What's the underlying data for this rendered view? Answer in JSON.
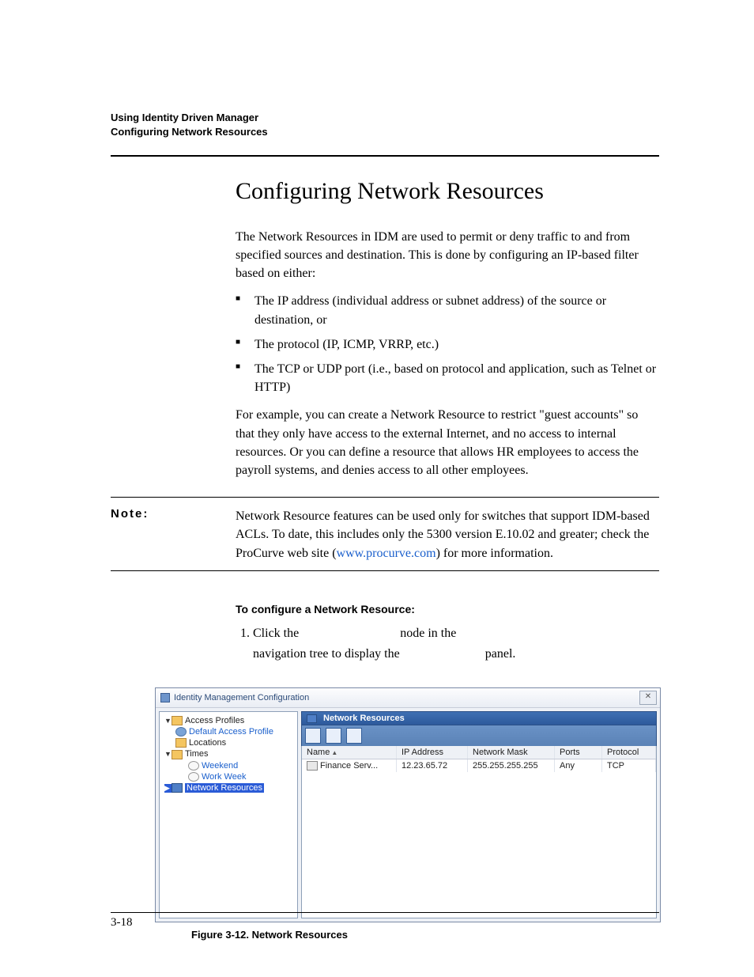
{
  "header": {
    "chapter": "Using Identity Driven Manager",
    "section": "Configuring Network Resources"
  },
  "title": "Configuring Network Resources",
  "intro": "The Network Resources in IDM are used to permit or deny traffic to and from specified sources and destination. This is done by configuring an IP-based filter based on either:",
  "bullets": [
    "The IP address (individual address or subnet address) of the source or destination, or",
    "The protocol (IP, ICMP, VRRP, etc.)",
    "The TCP or UDP port (i.e., based on protocol and application, such as Telnet or HTTP)"
  ],
  "example_para": "For example, you can create a Network Resource to restrict \"guest accounts\" so that they only have access to the external Internet, and no access to internal resources. Or you can define a resource that allows HR employees to access the payroll systems, and denies access to all other employees.",
  "note": {
    "label": "Note:",
    "text_before_link": "Network Resource features can be used only for switches that support IDM-based ACLs. To date, this includes only the 5300 version E.10.02 and greater; check the ProCurve web site (",
    "link_text": "www.procurve.com",
    "text_after_link": ") for more information."
  },
  "procedure": {
    "heading": "To configure a Network Resource:",
    "step1_a": "Click the ",
    "step1_b": " node in the ",
    "step1_c": "navigation tree to display the ",
    "step1_d": " panel."
  },
  "dialog": {
    "title": "Identity Management Configuration",
    "tree": {
      "access_profiles": "Access Profiles",
      "default_access_profile": "Default Access Profile",
      "locations": "Locations",
      "times": "Times",
      "weekend": "Weekend",
      "work_week": "Work Week",
      "network_resources": "Network Resources"
    },
    "panel_title": "Network Resources",
    "columns": {
      "name": "Name",
      "ip": "IP Address",
      "mask": "Network Mask",
      "ports": "Ports",
      "protocol": "Protocol"
    },
    "row": {
      "name": "Finance Serv...",
      "ip": "12.23.65.72",
      "mask": "255.255.255.255",
      "ports": "Any",
      "protocol": "TCP"
    }
  },
  "figure_caption": "Figure 3-12. Network Resources",
  "page_number": "3-18"
}
